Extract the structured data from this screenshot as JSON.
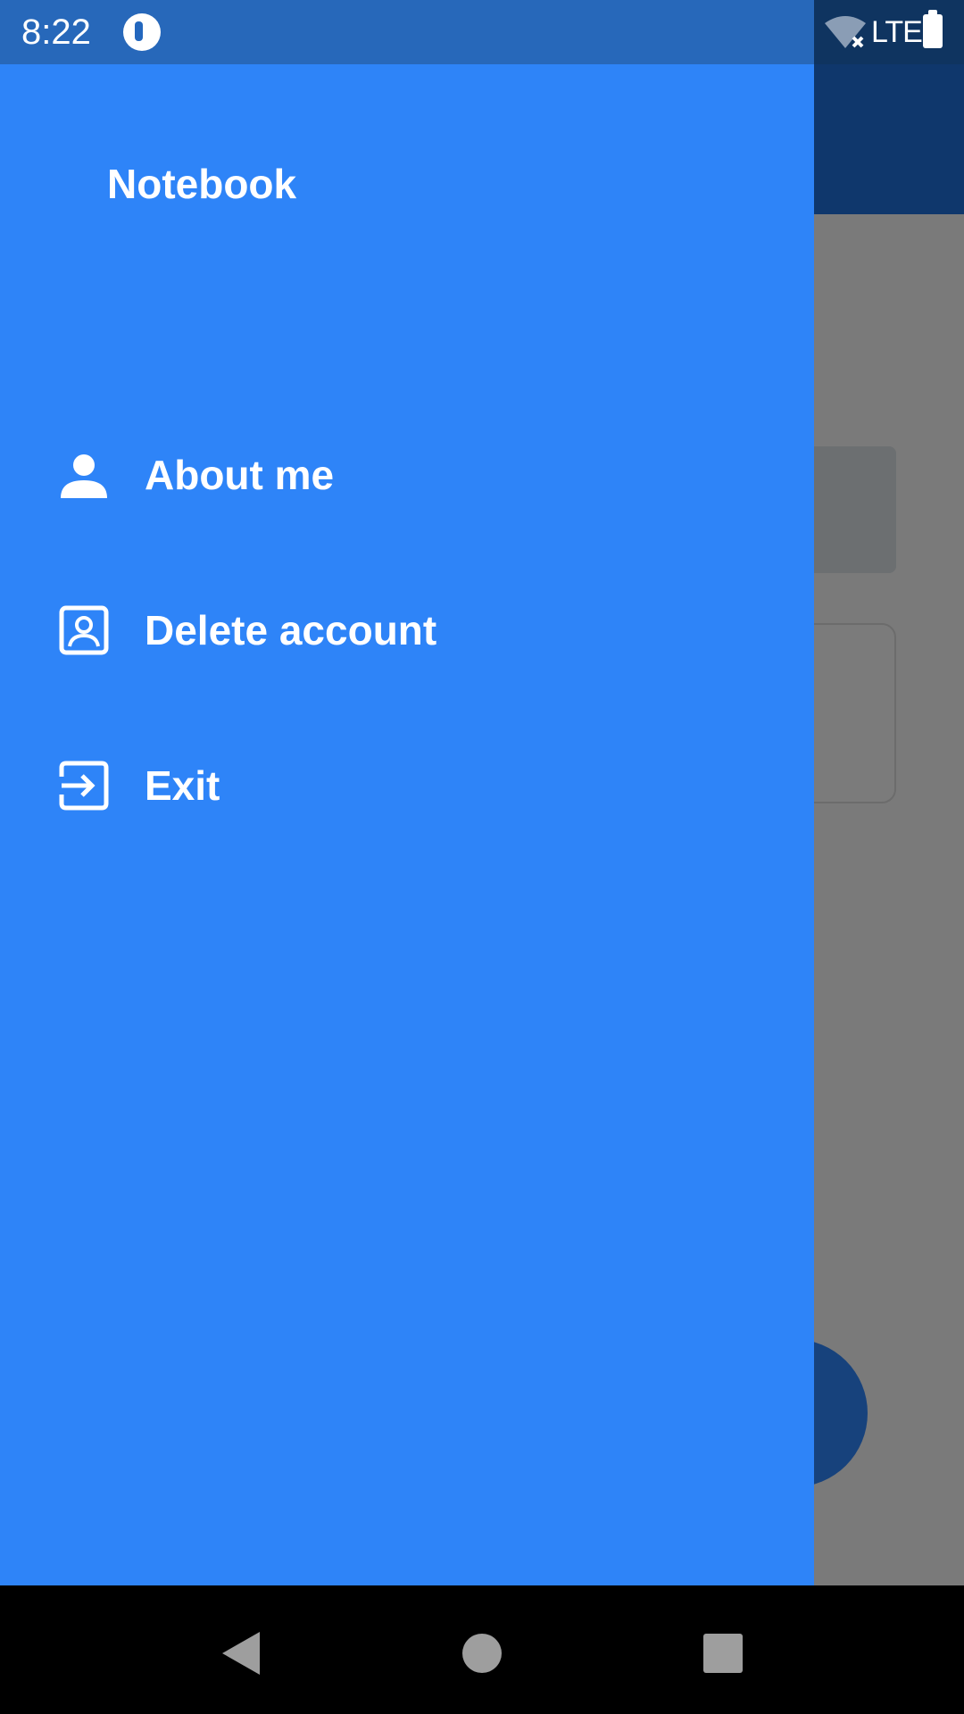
{
  "status_bar": {
    "time": "8:22",
    "network": "LTE",
    "icons": [
      "app-notification-icon",
      "wifi-off-icon",
      "battery-icon"
    ]
  },
  "drawer": {
    "title": "Notebook",
    "items": [
      {
        "label": "About me",
        "icon": "person-icon"
      },
      {
        "label": "Delete account",
        "icon": "account-box-icon"
      },
      {
        "label": "Exit",
        "icon": "exit-icon"
      }
    ]
  },
  "fab": {
    "icon": "plus-icon"
  },
  "nav_bar": {
    "icons": [
      "back-icon",
      "home-icon",
      "recents-icon"
    ]
  },
  "colors": {
    "drawer": "#2e84f8",
    "status_bar": "#2367be",
    "app_toolbar": "#1f6fd9",
    "scrim": "rgba(0,0,0,0.5)"
  }
}
